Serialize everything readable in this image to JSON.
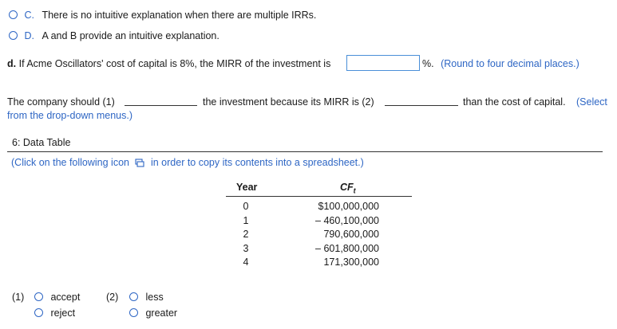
{
  "options": {
    "c": {
      "letter": "C.",
      "text": "There is no intuitive explanation when there are multiple IRRs."
    },
    "d": {
      "letter": "D.",
      "text": "A and B provide an intuitive explanation."
    }
  },
  "part_d": {
    "label": "d.",
    "prompt": "If Acme Oscillators' cost of capital is 8%, the MIRR of the investment is",
    "answer_value": "",
    "suffix": "%.",
    "hint": "(Round to four decimal places.)"
  },
  "conclusion": {
    "part1": "The company should (1)",
    "part2": "the investment because its MIRR is (2)",
    "part3": "than the cost of capital.",
    "select_line1": "(Select",
    "select_line2": "from the drop-down menus.)"
  },
  "data_table": {
    "title": "6: Data Table",
    "instruction_pre": "(Click on the following icon",
    "instruction_post": "in order to copy its contents into a spreadsheet.)",
    "col_year": "Year",
    "col_cf": "CF",
    "col_cf_sub": "t",
    "rows": [
      {
        "year": "0",
        "cf": "$100,000,000"
      },
      {
        "year": "1",
        "cf": "– 460,100,000"
      },
      {
        "year": "2",
        "cf": "790,600,000"
      },
      {
        "year": "3",
        "cf": "– 601,800,000"
      },
      {
        "year": "4",
        "cf": "171,300,000"
      }
    ]
  },
  "dropdown1": {
    "label": "(1)",
    "options": [
      "accept",
      "reject"
    ]
  },
  "dropdown2": {
    "label": "(2)",
    "options": [
      "less",
      "greater"
    ]
  },
  "icons": {
    "radio": "radio-circle",
    "copy": "copy-icon"
  }
}
